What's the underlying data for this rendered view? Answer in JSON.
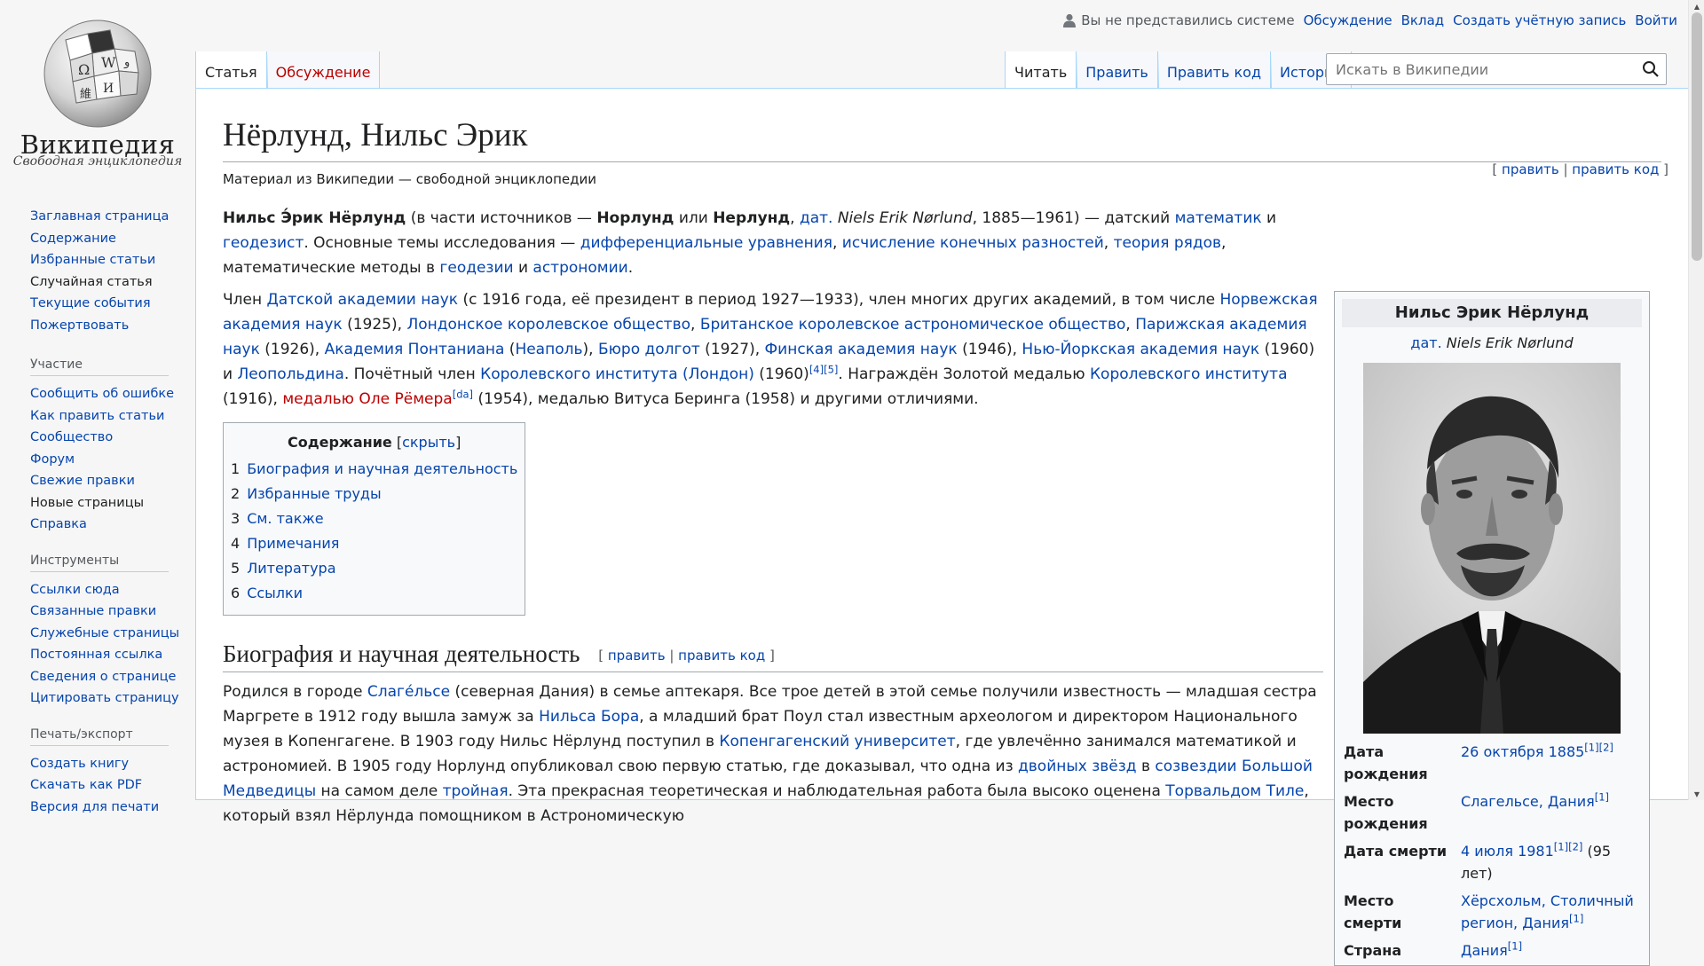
{
  "logo": {
    "wordmark": "Википедия",
    "tagline": "Свободная энциклопедия"
  },
  "personal": {
    "not_logged_in": "Вы не представились системе",
    "links": [
      "Обсуждение",
      "Вклад",
      "Создать учётную запись",
      "Войти"
    ]
  },
  "tabs": {
    "left": [
      "Статья",
      "Обсуждение"
    ],
    "right": [
      "Читать",
      "Править",
      "Править код",
      "История"
    ]
  },
  "search": {
    "placeholder": "Искать в Википедии"
  },
  "sidebar": {
    "nav": [
      "Заглавная страница",
      "Содержание",
      "Избранные статьи",
      "Случайная статья",
      "Текущие события",
      "Пожертвовать"
    ],
    "participation": {
      "title": "Участие",
      "items": [
        "Сообщить об ошибке",
        "Как править статьи",
        "Сообщество",
        "Форум",
        "Свежие правки",
        "Новые страницы",
        "Справка"
      ]
    },
    "tools": {
      "title": "Инструменты",
      "items": [
        "Ссылки сюда",
        "Связанные правки",
        "Служебные страницы",
        "Постоянная ссылка",
        "Сведения о странице",
        "Цитировать страницу"
      ]
    },
    "print": {
      "title": "Печать/экспорт",
      "items": [
        "Создать книгу",
        "Скачать как PDF",
        "Версия для печати"
      ]
    }
  },
  "article": {
    "title": "Нёрлунд, Нильс Эрик",
    "site_sub": "Материал из Википедии — свободной энциклопедии",
    "edit_links": {
      "edit": "править",
      "edit_code": "править код"
    },
    "toc": {
      "title": "Содержание",
      "hide": "скрыть",
      "items": [
        {
          "num": "1",
          "label": "Биография и научная деятельность"
        },
        {
          "num": "2",
          "label": "Избранные труды"
        },
        {
          "num": "3",
          "label": "См. также"
        },
        {
          "num": "4",
          "label": "Примечания"
        },
        {
          "num": "5",
          "label": "Литература"
        },
        {
          "num": "6",
          "label": "Ссылки"
        }
      ]
    },
    "section1": {
      "title": "Биография и научная деятельность",
      "edit": "править",
      "edit_code": "править код"
    }
  },
  "infobox": {
    "name": "Нильс Эрик Нёрлунд",
    "lang": "дат.",
    "native_name": "Niels Erik Nørlund",
    "rows": [
      {
        "label": "Дата рождения",
        "value": "26 октября 1885",
        "refs": "[1][2]"
      },
      {
        "label": "Место рождения",
        "value": "Слагельсе, Дания",
        "refs": "[1]"
      },
      {
        "label": "Дата смерти",
        "value": "4 июля 1981",
        "refs": "[1][2]",
        "extra": " (95 лет)"
      },
      {
        "label": "Место смерти",
        "value": "Хёрсхольм, Столичный регион, Дания",
        "refs": "[1]"
      },
      {
        "label": "Страна",
        "value": "Дания",
        "refs": "[1]"
      }
    ]
  }
}
